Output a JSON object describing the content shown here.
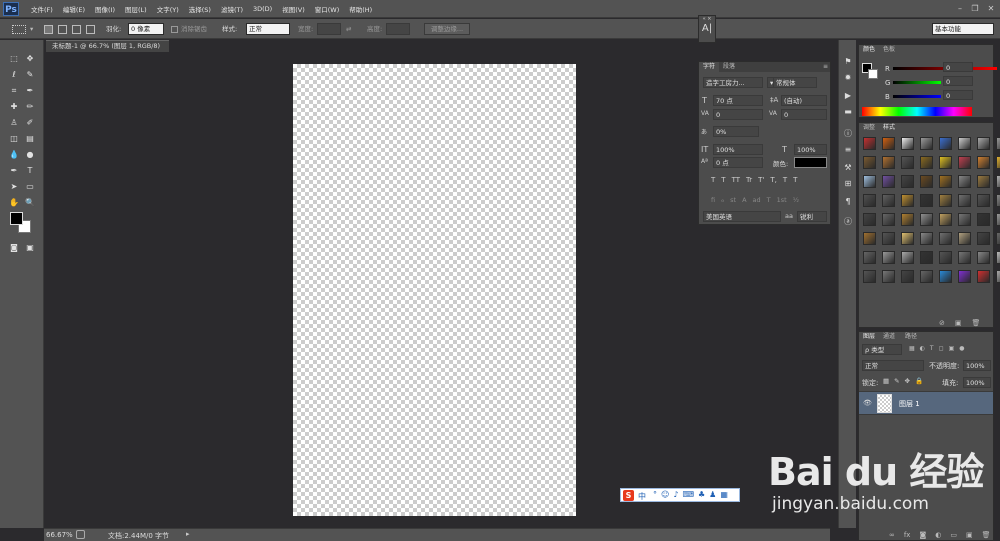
{
  "app": {
    "logo": "Ps"
  },
  "menu": [
    "文件(F)",
    "编辑(E)",
    "图像(I)",
    "图层(L)",
    "文字(Y)",
    "选择(S)",
    "滤镜(T)",
    "3D(D)",
    "视图(V)",
    "窗口(W)",
    "帮助(H)"
  ],
  "window_controls": {
    "minimize": "–",
    "restore": "❐",
    "close": "✕"
  },
  "options": {
    "feather_label": "羽化:",
    "feather_value": "0 像素",
    "antialias_label": "消除锯齿",
    "style_label": "样式:",
    "style_value": "正常",
    "width_label": "宽度:",
    "height_label": "高度:",
    "refine_edge": "调整边缘...",
    "workspace": "基本功能"
  },
  "document": {
    "tab_title": "未标题-1 @ 66.7% (图层 1, RGB/8)",
    "close": "×"
  },
  "status": {
    "zoom": "66.67%",
    "doc_info": "文档:2.44M/0 字节"
  },
  "character_panel": {
    "tab_character": "字符",
    "tab_paragraph": "段落",
    "font_family": "造字工房力...",
    "font_style": "常规体",
    "font_size": "70 点",
    "leading": "(自动)",
    "kerning": "0",
    "tracking": "0",
    "baseline_scale": "0%",
    "vertical_scale": "100%",
    "horizontal_scale": "100%",
    "baseline_shift": "0 点",
    "color_label": "颜色:",
    "style_buttons": [
      "T",
      "T",
      "TT",
      "Tr",
      "T'",
      "T,",
      "T",
      "T"
    ],
    "opentype_buttons": [
      "fi",
      "ℴ",
      "st",
      "A",
      "ad",
      "T",
      "1st",
      "½"
    ],
    "language": "美国英语",
    "aa_label": "aa",
    "aa_value": "锐利"
  },
  "color_panel": {
    "tab_color": "颜色",
    "tab_swatches": "色板",
    "r_label": "R",
    "r_value": "0",
    "g_label": "G",
    "g_value": "0",
    "b_label": "B",
    "b_value": "0"
  },
  "styles_panel": {
    "tab_adjust": "调整",
    "tab_styles": "样式"
  },
  "layers_panel": {
    "tab_layers": "图层",
    "tab_channels": "通道",
    "tab_paths": "路径",
    "filter_label": "ρ 类型",
    "blend_mode": "正常",
    "opacity_label": "不透明度:",
    "opacity_value": "100%",
    "lock_label": "锁定:",
    "fill_label": "填充:",
    "fill_value": "100%",
    "layer_name": "图层 1"
  },
  "ime": {
    "logo": "S",
    "mode": "中"
  },
  "watermark": {
    "brand": "Bai du 经验",
    "url": "jingyan.baidu.com"
  }
}
